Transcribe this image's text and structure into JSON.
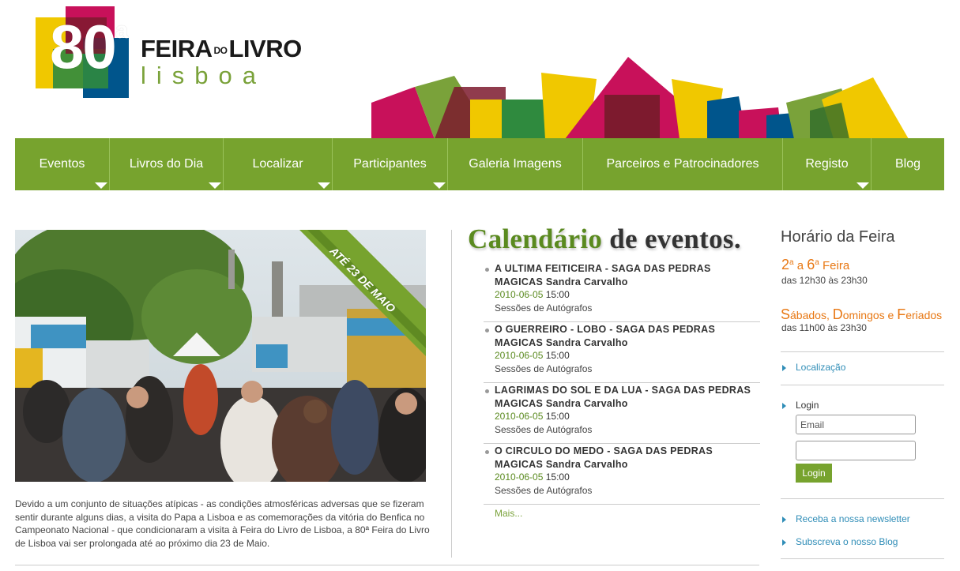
{
  "logo": {
    "number": "80",
    "superscript": "a",
    "title_part1": "FEIRA",
    "title_do": "DO",
    "title_part2": "LIVRO",
    "city": "lisboa"
  },
  "nav": {
    "items": [
      {
        "label": "Eventos",
        "dropdown": true
      },
      {
        "label": "Livros do Dia",
        "dropdown": true
      },
      {
        "label": "Localizar",
        "dropdown": true
      },
      {
        "label": "Participantes",
        "dropdown": true
      },
      {
        "label": "Galeria Imagens",
        "dropdown": false
      },
      {
        "label": "Parceiros e Patrocinadores",
        "dropdown": false
      },
      {
        "label": "Registo",
        "dropdown": true
      },
      {
        "label": "Blog",
        "dropdown": false
      }
    ]
  },
  "photo": {
    "ribbon": "ATÉ 23 DE MAIO"
  },
  "intro_text": "Devido a um conjunto de situações atípicas - as condições atmosféricas adversas que se fizeram sentir durante alguns dias, a visita do Papa a Lisboa e as comemorações da vitória do Benfica no Campeonato Nacional - que condicionaram a visita à Feira do Livro de Lisboa, a 80ª Feira do Livro de Lisboa vai ser prolongada até ao próximo dia 23 de Maio.",
  "calendar": {
    "title_word1": "Calendário",
    "title_word2": "de eventos.",
    "events": [
      {
        "title": "A ULTIMA FEITICEIRA - SAGA DAS PEDRAS MAGICAS Sandra Carvalho",
        "date": "2010-06-05",
        "time": "15:00",
        "type": "Sessões de Autógrafos"
      },
      {
        "title": "O GUERREIRO - LOBO - SAGA DAS PEDRAS MAGICAS Sandra Carvalho",
        "date": "2010-06-05",
        "time": "15:00",
        "type": "Sessões de Autógrafos"
      },
      {
        "title": "LAGRIMAS DO SOL E DA LUA - SAGA DAS PEDRAS MAGICAS Sandra Carvalho",
        "date": "2010-06-05",
        "time": "15:00",
        "type": "Sessões de Autógrafos"
      },
      {
        "title": "O CIRCULO DO MEDO - SAGA DAS PEDRAS MAGICAS Sandra Carvalho",
        "date": "2010-06-05",
        "time": "15:00",
        "type": "Sessões de Autógrafos"
      }
    ],
    "more_label": "Mais..."
  },
  "schedule": {
    "title": "Horário da Feira",
    "weekdays_from": "2",
    "weekdays_sup": "a",
    "weekdays_a": "a",
    "weekdays_to": "6",
    "weekdays_sup2": "a",
    "weekdays_word": "Feira",
    "weekdays_hours": "das 12h30 às 23h30",
    "weekend_label_s": "S",
    "weekend_label_1": "ábados, ",
    "weekend_label_d": "D",
    "weekend_label_2": "omingos",
    "weekend_label_e": " e ",
    "weekend_label_f": "F",
    "weekend_label_3": "eriados",
    "weekend_hours": "das 11h00 às 23h30"
  },
  "sidebar": {
    "location_link": "Localização",
    "login_label": "Login",
    "email_placeholder": "Email",
    "login_button": "Login",
    "newsletter_link": "Receba a nossa newsletter",
    "blog_link": "Subscreva o nosso Blog"
  },
  "colors": {
    "brand_green": "#77a32e",
    "accent_orange": "#e87814",
    "link_blue": "#2f8db7"
  }
}
